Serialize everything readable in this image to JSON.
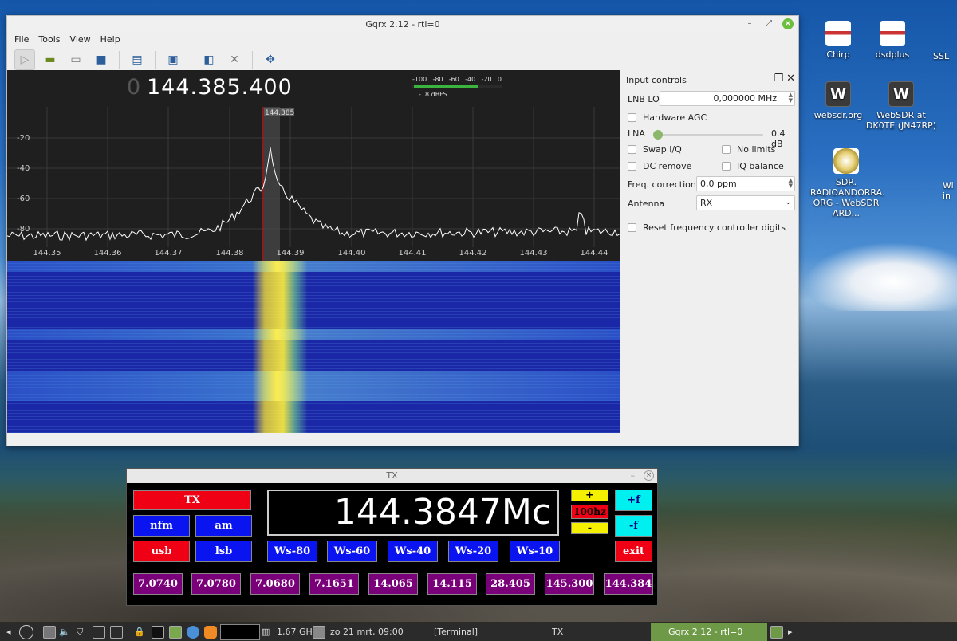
{
  "desktop": {
    "icons": [
      {
        "label": "Chirp"
      },
      {
        "label": "dsdplus"
      },
      {
        "label": "SSL"
      },
      {
        "label": "websdr.org"
      },
      {
        "label": "WebSDR at DK0TE (JN47RP)"
      },
      {
        "label": "SDR. RADIOANDORRA. ORG - WebSDR ARD..."
      },
      {
        "label": "Wi in"
      }
    ]
  },
  "gqrx": {
    "title": "Gqrx 2.12 - rtl=0",
    "menu": [
      "File",
      "Tools",
      "View",
      "Help"
    ],
    "freq_prefix": "0",
    "frequency": "144.385.400",
    "meter": {
      "scale": [
        "-100",
        "-80",
        "-60",
        "-40",
        "-20",
        "0"
      ],
      "level": "-18 dBFS",
      "fill": 0.73
    },
    "marker_label": "144.385",
    "y_ticks": [
      "-20",
      "-40",
      "-60",
      "-80"
    ],
    "x_ticks": [
      "144.35",
      "144.36",
      "144.37",
      "144.38",
      "144.39",
      "144.40",
      "144.41",
      "144.42",
      "144.43",
      "144.44"
    ],
    "panel": {
      "title": "Input controls",
      "lnb_lo_label": "LNB LO",
      "lnb_lo_value": "0,000000 MHz",
      "hw_agc": "Hardware AGC",
      "lna_label": "LNA",
      "lna_value": "0.4 dB",
      "swap_iq": "Swap I/Q",
      "no_limits": "No limits",
      "dc_remove": "DC remove",
      "iq_balance": "IQ balance",
      "freq_corr_label": "Freq. correction",
      "freq_corr_value": "0,0 ppm",
      "antenna_label": "Antenna",
      "antenna_value": "RX",
      "reset_label": "Reset frequency controller digits"
    }
  },
  "tx": {
    "title": "TX",
    "minimize": "–",
    "close": "×",
    "tx_label": "TX",
    "nfm": "nfm",
    "am": "am",
    "usb": "usb",
    "lsb": "lsb",
    "frequency": "144.3847Mc",
    "plus": "+",
    "step": "100hz",
    "minus": "-",
    "plus_f": "+f",
    "minus_f": "-f",
    "ws": [
      "Ws-80",
      "Ws-60",
      "Ws-40",
      "Ws-20",
      "Ws-10"
    ],
    "exit": "exit",
    "presets": [
      "7.0740",
      "7.0780",
      "7.0680",
      "7.1651",
      "14.065",
      "14.115",
      "28.405",
      "145.300",
      "144.384"
    ]
  },
  "taskbar": {
    "cpu": "1,67 GHz",
    "clock": "zo 21 mrt, 09:00",
    "tasks": [
      "[Terminal]",
      "TX",
      "Gqrx 2.12 - rtl=0"
    ]
  }
}
